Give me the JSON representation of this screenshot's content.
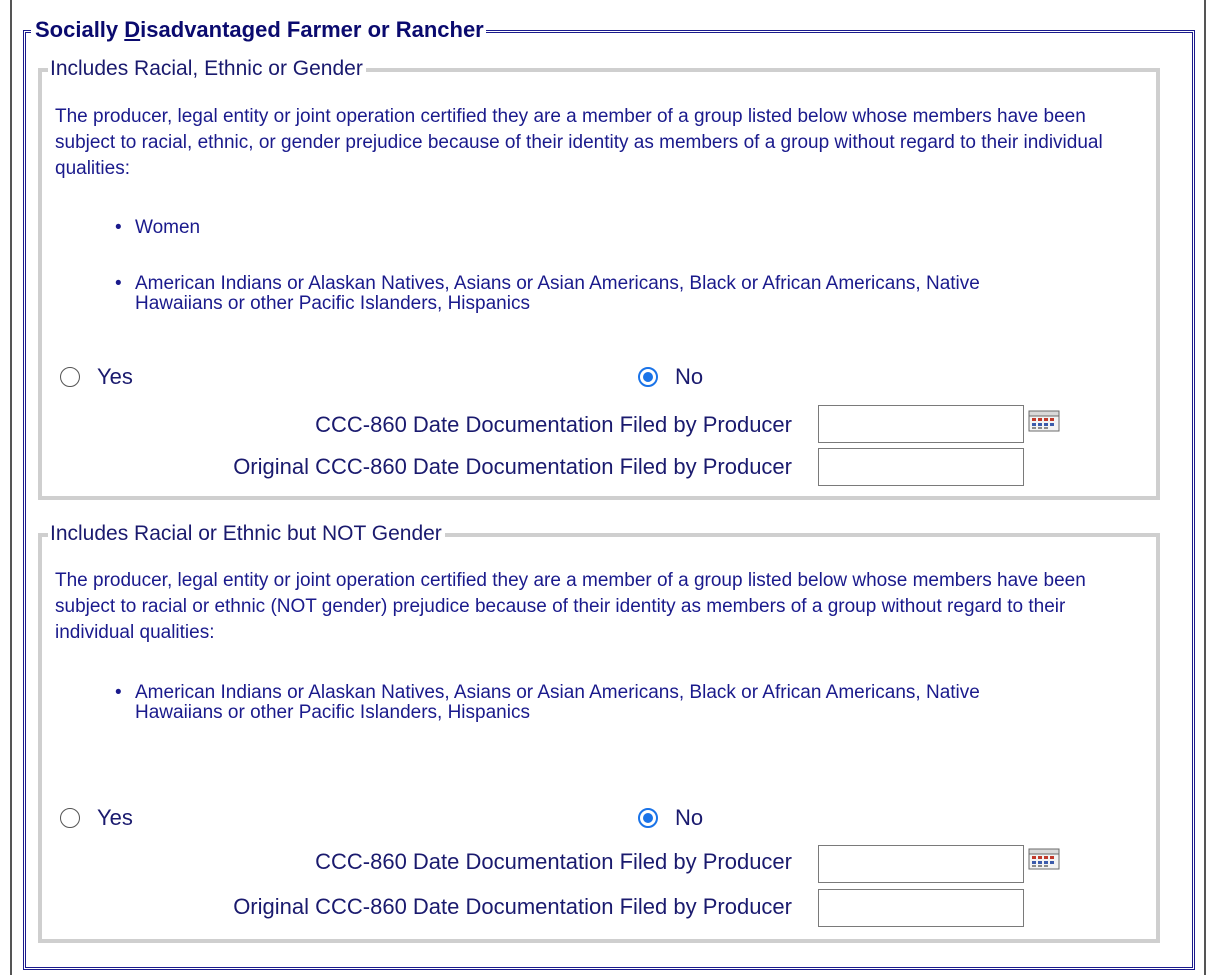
{
  "section": {
    "legend_before": "Socially ",
    "legend_underlined": "D",
    "legend_after": "isadvantaged Farmer or Rancher"
  },
  "group1": {
    "legend": "Includes Racial, Ethnic or Gender",
    "description": "The producer, legal entity or joint operation certified they are a member of a group listed below whose members have been subject to racial, ethnic, or gender prejudice because of their identity as members of a group without regard to their individual qualities:",
    "bullets": [
      "Women",
      "American Indians or Alaskan Natives, Asians or Asian Americans, Black or African Americans, Native Hawaiians or other Pacific Islanders, Hispanics"
    ],
    "yes_label": "Yes",
    "no_label": "No",
    "selected": "No",
    "date_label": "CCC-860 Date Documentation Filed by Producer",
    "date_value": "",
    "original_date_label": "Original CCC-860 Date Documentation Filed by Producer",
    "original_date_value": ""
  },
  "group2": {
    "legend": "Includes Racial or Ethnic but NOT Gender",
    "description": "The producer, legal entity or joint operation certified they are a member of a group listed below whose members have been subject to racial or ethnic (NOT gender) prejudice because of their identity as members of a group without regard to their individual qualities:",
    "bullets": [
      "American Indians or Alaskan Natives, Asians or Asian Americans, Black or African Americans, Native Hawaiians or other Pacific Islanders, Hispanics"
    ],
    "yes_label": "Yes",
    "no_label": "No",
    "selected": "No",
    "date_label": "CCC-860 Date Documentation Filed by Producer",
    "date_value": "",
    "original_date_label": "Original CCC-860 Date Documentation Filed by Producer",
    "original_date_value": ""
  },
  "icons": {
    "calendar": "calendar-icon"
  },
  "colors": {
    "text": "#1a1a6e",
    "legend_border": "#1a1a8c",
    "group_border": "#cfcfcf",
    "radio_checked": "#1a73e8"
  }
}
